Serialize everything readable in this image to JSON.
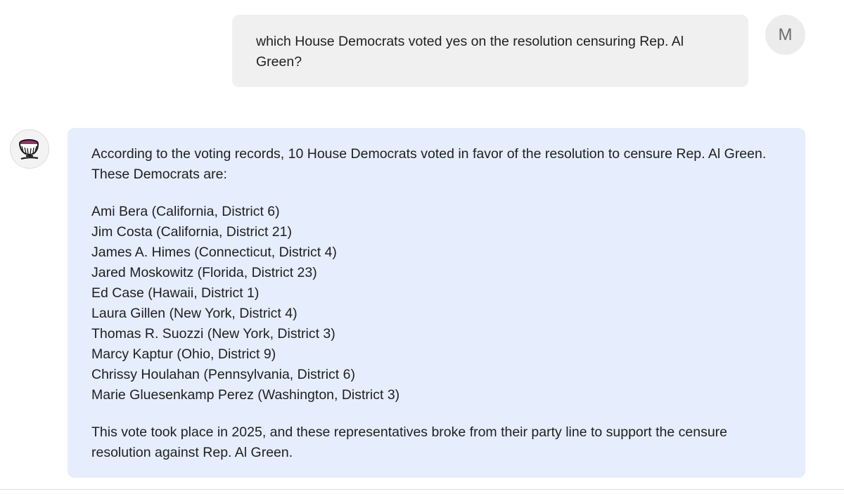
{
  "user": {
    "avatar_initial": "M",
    "message": "which House Democrats voted yes on the resolution censuring Rep. Al Green?"
  },
  "assistant": {
    "avatar_icon": "chalice-icon",
    "intro": "According to the voting records, 10 House Democrats voted in favor of the resolution to censure Rep. Al Green. These Democrats are:",
    "representatives": [
      "Ami Bera (California, District 6)",
      "Jim Costa (California, District 21)",
      "James A. Himes (Connecticut, District 4)",
      "Jared Moskowitz (Florida, District 23)",
      "Ed Case (Hawaii, District 1)",
      "Laura Gillen (New York, District 4)",
      "Thomas R. Suozzi (New York, District 3)",
      "Marcy Kaptur (Ohio, District 9)",
      "Chrissy Houlahan (Pennsylvania, District 6)",
      "Marie Gluesenkamp Perez (Washington, District 3)"
    ],
    "outro": "This vote took place in 2025, and these representatives broke from their party line to support the censure resolution against Rep. Al Green."
  },
  "colors": {
    "user_bubble": "#f0f0f0",
    "assistant_bubble": "#e6edfc",
    "avatar_accent": "#8c3a63"
  }
}
